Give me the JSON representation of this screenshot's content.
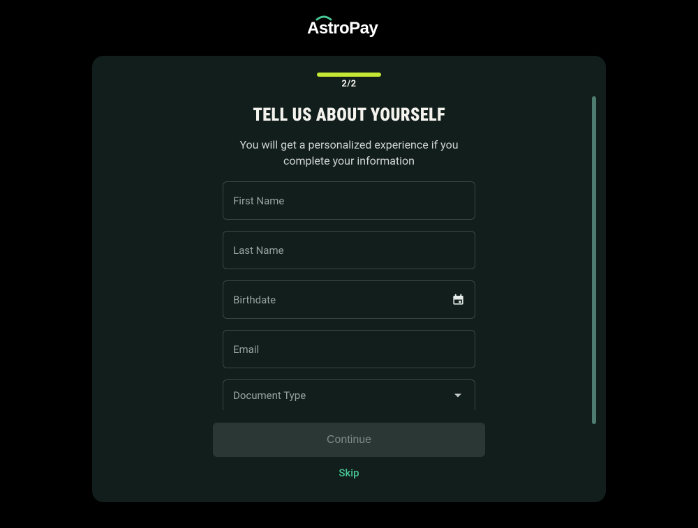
{
  "brand": "AstroPay",
  "progress": {
    "label": "2/2"
  },
  "heading": "TELL US ABOUT YOURSELF",
  "subheading": "You will get a personalized experience if you complete your information",
  "fields": {
    "first_name": {
      "placeholder": "First Name"
    },
    "last_name": {
      "placeholder": "Last Name"
    },
    "birthdate": {
      "placeholder": "Birthdate"
    },
    "email": {
      "placeholder": "Email"
    },
    "document_type": {
      "placeholder": "Document Type"
    }
  },
  "buttons": {
    "continue": "Continue",
    "skip": "Skip"
  },
  "colors": {
    "accent_green": "#48c796",
    "progress_lime": "#c5e834",
    "card_bg": "#111e1b"
  }
}
